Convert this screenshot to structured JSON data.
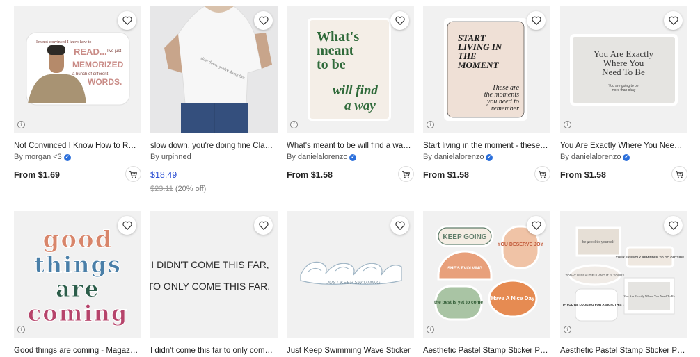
{
  "products": [
    {
      "title": "Not Convinced I Know How to Read…",
      "artist": "By morgan <3",
      "verified": true,
      "price": "From $1.69",
      "art_text": [
        "I'm not convinced I know how to",
        "READ...",
        "I've just",
        "MEMORIZED",
        "a bunch of different",
        "WORDS."
      ],
      "icons": [
        "heart-icon",
        "info-icon",
        "cart-icon"
      ]
    },
    {
      "title": "slow down, you're doing fine Classic T-Shirt",
      "artist": "By urpinned",
      "verified": false,
      "price": "$18.49",
      "original_price": "$23.11",
      "discount": "(20% off)",
      "art_text": [
        "slow down, you're doing fine"
      ]
    },
    {
      "title": "What's meant to be will find a way Sticker",
      "artist": "By danielalorenzo",
      "verified": true,
      "price": "From $1.58",
      "art_text": [
        "What's",
        "meant",
        "to be",
        "will find",
        "a way"
      ]
    },
    {
      "title": "Start living in the moment - these are the moments",
      "artist": "By danielalorenzo",
      "verified": true,
      "price": "From $1.58",
      "art_text": [
        "START",
        "LIVING IN",
        "THE",
        "MOMENT",
        "These are",
        "the moments",
        "you need to",
        "remember"
      ]
    },
    {
      "title": "You Are Exactly Where You Need To Be Sticker",
      "artist": "By danielalorenzo",
      "verified": true,
      "price": "From $1.58",
      "art_text": [
        "You Are Exactly",
        "Where You",
        "Need To Be",
        "You are going to be",
        "more than okay"
      ]
    },
    {
      "title": "Good things are coming - Magazine Cutout Sticker",
      "art_text": [
        "good",
        "things",
        "are",
        "coming"
      ]
    },
    {
      "title": "I didn't come this far to only come this far Sticker",
      "art_text": [
        "I DIDN'T COME THIS FAR,",
        "TO ONLY COME THIS FAR."
      ]
    },
    {
      "title": "Just Keep Swimming Wave Sticker",
      "art_text": [
        "JUST KEEP SWIMMING"
      ]
    },
    {
      "title": "Aesthetic Pastel Stamp Sticker Pack Sticker",
      "art_text": [
        "KEEP GOING",
        "YOU DESERVE JOY",
        "SHE'S EVOLVING",
        "the best is yet to come",
        "Have A Nice Day"
      ]
    },
    {
      "title": "Aesthetic Pastel Stamp Sticker Pack Sticker",
      "art_text": [
        "be good to yourself",
        "YOUR FRIENDLY REMINDER TO GO OUTSIDE",
        "TODAY IS BEAUTIFUL AND IT IS YOURS",
        "IF YOU'RE LOOKING FOR A SIGN, THIS IS IT.",
        "You Are Exactly Where You Need To Be"
      ]
    }
  ],
  "colors": {
    "accent_blue": "#2f52d3",
    "verified": "#2b6fdb",
    "thumb_bg": "#f1f1f1"
  }
}
